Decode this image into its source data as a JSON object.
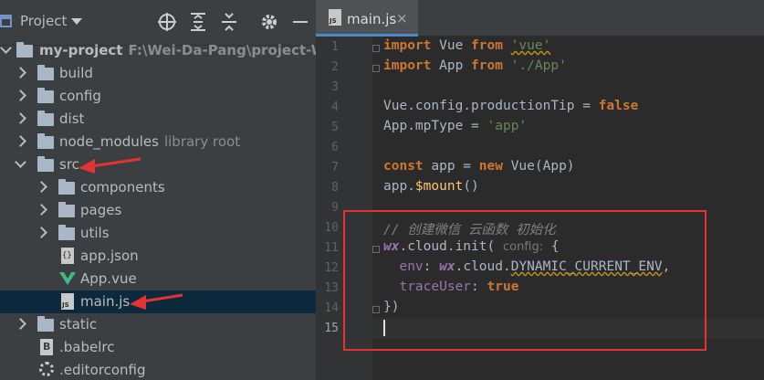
{
  "panel": {
    "title": "Project",
    "toolbar": [
      "locate-icon",
      "expand-all-icon",
      "collapse-all-icon",
      "gear-icon",
      "minimize-icon"
    ]
  },
  "tree": {
    "root": {
      "name": "my-project",
      "path": "F:\\Wei-Da-Pang\\project-WX\\my-"
    },
    "items": [
      {
        "name": "build",
        "type": "folder"
      },
      {
        "name": "config",
        "type": "folder"
      },
      {
        "name": "dist",
        "type": "folder"
      },
      {
        "name": "node_modules",
        "type": "folder",
        "hint": "library root"
      },
      {
        "name": "src",
        "type": "folder"
      },
      {
        "name": "components",
        "type": "folder"
      },
      {
        "name": "pages",
        "type": "folder"
      },
      {
        "name": "utils",
        "type": "folder"
      },
      {
        "name": "app.json",
        "type": "json"
      },
      {
        "name": "App.vue",
        "type": "vue"
      },
      {
        "name": "main.js",
        "type": "js"
      },
      {
        "name": "static",
        "type": "folder"
      },
      {
        "name": ".babelrc",
        "type": "babel"
      },
      {
        "name": ".editorconfig",
        "type": "config"
      }
    ]
  },
  "editor": {
    "tab": {
      "label": "main.js",
      "close": "×",
      "icon_text": "JS"
    },
    "line_numbers": [
      "1",
      "2",
      "3",
      "4",
      "5",
      "6",
      "7",
      "8",
      "9",
      "10",
      "11",
      "12",
      "13",
      "14",
      "15"
    ],
    "code": {
      "l1": {
        "kw1": "import",
        "id": " Vue ",
        "kw2": "from",
        "sp": " ",
        "str": "'vue'"
      },
      "l2": {
        "kw1": "import",
        "id": " App ",
        "kw2": "from",
        "sp": " ",
        "str": "'./App'"
      },
      "l4": {
        "a": "Vue.config.productionTip = ",
        "kw": "false"
      },
      "l5": {
        "a": "App.mpType = ",
        "str": "'app'"
      },
      "l7": {
        "kw1": "const",
        "a": " app = ",
        "kw2": "new",
        "b": " Vue(App)"
      },
      "l8": {
        "a": "app.",
        "fn": "$mount",
        "b": "()"
      },
      "l10": {
        "comment": "// 创建微信 云函数 初始化"
      },
      "l11": {
        "glob": "wx",
        "a": ".cloud.init( ",
        "param": "config:",
        "b": " {"
      },
      "l12": {
        "a": "  ",
        "prop": "env",
        "b": ": ",
        "glob": "wx",
        "c": ".cloud.",
        "d": "DYNAMIC_CURRENT_ENV",
        "e": ","
      },
      "l13": {
        "a": "  ",
        "prop": "traceUser",
        "b": ": ",
        "kw": "true"
      },
      "l14": {
        "a": "})"
      }
    }
  },
  "colors": {
    "annotation": "#e53232",
    "accent": "#4a88c7"
  }
}
